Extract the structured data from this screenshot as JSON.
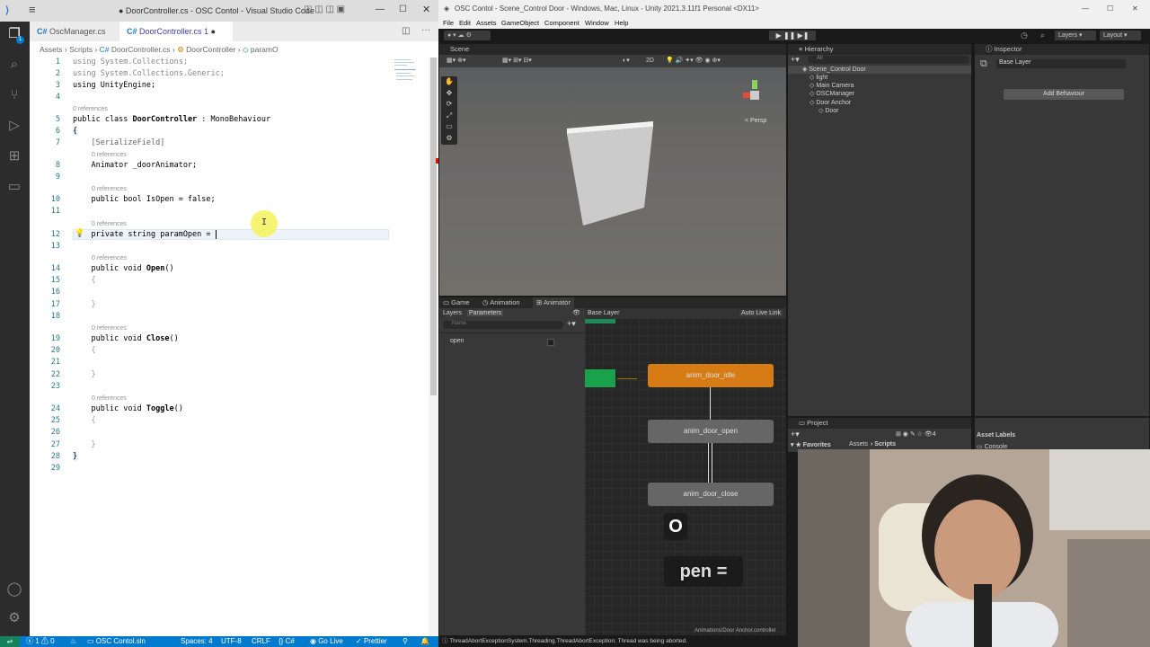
{
  "vscode": {
    "title": "● DoorController.cs - OSC Contol - Visual Studio Code",
    "tabs": [
      {
        "label": "OscManager.cs"
      },
      {
        "label": "DoorController.cs 1"
      }
    ],
    "breadcrumb": [
      "Assets",
      "Scripts",
      "DoorController.cs",
      "DoorController",
      "paramO"
    ],
    "code": {
      "l1": "using System.Collections;",
      "l2": "using System.Collections.Generic;",
      "l3": "using UnityEngine;",
      "l5a": "public class ",
      "l5b": "DoorController",
      " l5c": "",
      "l5rest": " : MonoBehaviour",
      "l6": "{",
      "l7": "    [SerializeField]",
      "l8": "    Animator _doorAnimator;",
      "l10": "    public bool IsOpen = false;",
      "l12": "    private string paramOpen = ",
      "l14a": "    public void ",
      "l14b": "Open",
      "l14c": "()",
      "l15": "    {",
      "l17": "    }",
      "l19a": "    public void ",
      "l19b": "Close",
      "l19c": "()",
      "l20": "    {",
      "l22": "    }",
      "l24a": "    public void ",
      "l24b": "Toggle",
      "l24c": "()",
      "l25": "    {",
      "l27": "    }",
      "l28": "}"
    },
    "refs": "0 references",
    "status": {
      "errors": "ⓧ 1 ⚠ 0",
      "sln": "OSC Contol.sln",
      "spaces": "Spaces: 4",
      "enc": "UTF-8",
      "eol": "CRLF",
      "lang": "C#",
      "golive": "Go Live",
      "prettier": "Prettier"
    }
  },
  "unity": {
    "title": "OSC Contol - Scene_Control Door - Windows, Mac, Linux - Unity 2021.3.11f1 Personal <DX11>",
    "menu": [
      "File",
      "Edit",
      "Assets",
      "GameObject",
      "Component",
      "Window",
      "Help"
    ],
    "layers": "Layers",
    "layout": "Layout",
    "scene": {
      "tab": "Scene",
      "mode": "2D",
      "persp": "< Persp"
    },
    "hierarchy": {
      "tab": "Hierarchy",
      "search": "All",
      "items": [
        "Scene_Control Door",
        "light",
        "Main Camera",
        "OSCManager",
        "Door Anchor",
        "Door"
      ]
    },
    "inspector": {
      "tab": "Inspector",
      "layer": "Base Layer",
      "add_button": "Add Behaviour"
    },
    "animator": {
      "tabs": [
        "Game",
        "Animation",
        "Animator"
      ],
      "subtabs": [
        "Layers",
        "Parameters"
      ],
      "search": "Name",
      "param": "open",
      "layer": "Base Layer",
      "autolive": "Auto Live Link",
      "path": "Animations/Door Anchor.controller",
      "nodes": [
        "anim_door_idle",
        "anim_door_open",
        "anim_door_close"
      ]
    },
    "project": {
      "tab": "Project",
      "favorites": "Favorites",
      "crumb1": "Assets",
      "crumb2": "Scripts",
      "labels": "Asset Labels",
      "console": "Console",
      "count": "4"
    },
    "status": "ThreadAbortExceptionSystem.Threading.ThreadAbortException: Thread was being aborted.",
    "overlay": {
      "o": "O",
      "pen": "pen ="
    }
  }
}
